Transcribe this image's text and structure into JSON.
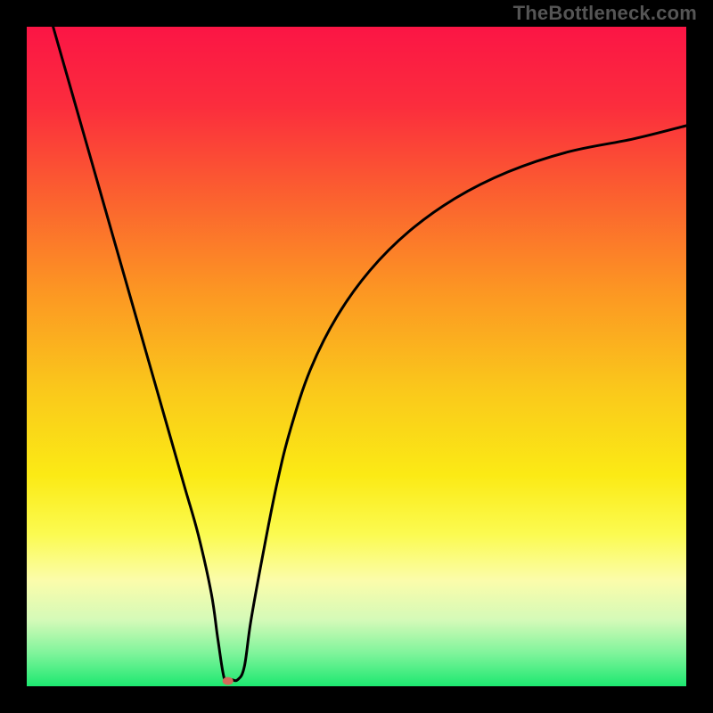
{
  "watermark": "TheBottleneck.com",
  "chart_data": {
    "type": "line",
    "title": "",
    "xlabel": "",
    "ylabel": "",
    "xlim": [
      0,
      100
    ],
    "ylim": [
      0,
      100
    ],
    "grid": false,
    "background": {
      "type": "vertical-gradient",
      "stops": [
        {
          "offset": 0.0,
          "color": "#fb1545"
        },
        {
          "offset": 0.12,
          "color": "#fb2d3d"
        },
        {
          "offset": 0.25,
          "color": "#fb5e30"
        },
        {
          "offset": 0.4,
          "color": "#fc9623"
        },
        {
          "offset": 0.55,
          "color": "#fac81b"
        },
        {
          "offset": 0.68,
          "color": "#fbea15"
        },
        {
          "offset": 0.77,
          "color": "#fbfb51"
        },
        {
          "offset": 0.84,
          "color": "#fbfcab"
        },
        {
          "offset": 0.9,
          "color": "#d4fab8"
        },
        {
          "offset": 0.95,
          "color": "#7ff49b"
        },
        {
          "offset": 1.0,
          "color": "#1de870"
        }
      ]
    },
    "border_color": "#000000",
    "border_width": 30,
    "series": [
      {
        "name": "bottleneck-curve",
        "description": "V-shaped curve plunging from upper left to a minimum then rising asymptotically to the right",
        "color": "#000000",
        "stroke_width": 3,
        "x": [
          4,
          6,
          8,
          10,
          12,
          14,
          16,
          18,
          20,
          22,
          24,
          26,
          28,
          29,
          30,
          31,
          32,
          33,
          34,
          36,
          38,
          40,
          43,
          47,
          52,
          58,
          65,
          73,
          82,
          92,
          100
        ],
        "values": [
          100,
          93,
          86,
          79,
          72,
          65,
          58,
          51,
          44,
          37,
          30,
          23,
          14,
          7,
          1,
          1,
          1,
          3,
          10,
          21,
          31,
          39,
          48,
          56,
          63,
          69,
          74,
          78,
          81,
          83,
          85
        ]
      }
    ],
    "marker": {
      "name": "minimum-point",
      "x": 30.5,
      "y": 0.8,
      "rx": 6,
      "ry": 4.5,
      "color": "#d36a5a"
    }
  }
}
